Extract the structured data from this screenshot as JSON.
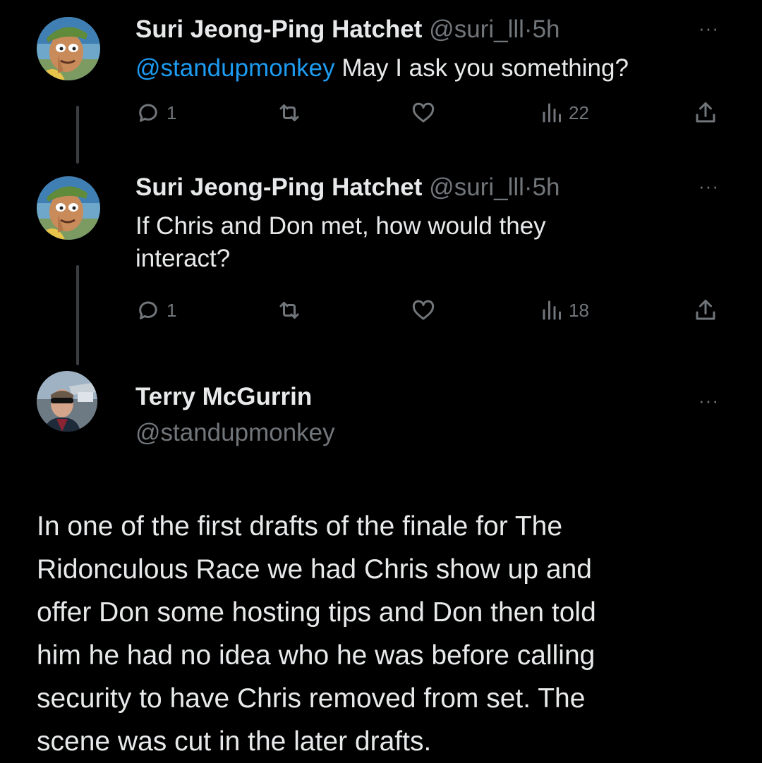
{
  "tweets": [
    {
      "author_name": "Suri Jeong-Ping Hatchet",
      "handle": "@suri_lll",
      "separator": "·",
      "time": "5h",
      "mention": "@standupmonkey",
      "text": " May I ask you something?",
      "reply_count": "1",
      "views": "22"
    },
    {
      "author_name": "Suri Jeong-Ping Hatchet",
      "handle": "@suri_lll",
      "separator": "·",
      "time": "5h",
      "text_line1": "If Chris and Don met, how would they",
      "text_line2": "interact?",
      "reply_count": "1",
      "views": "18"
    }
  ],
  "main_tweet": {
    "author_name": "Terry McGurrin",
    "handle": "@standupmonkey",
    "text_lines": [
      "In one of the first drafts of the finale for The",
      "Ridonculous Race we had Chris show up and",
      "offer Don some hosting tips and Don then told",
      "him he had no idea who he was before calling",
      "security to have Chris removed from set. The",
      "scene was cut in the later drafts."
    ]
  },
  "more_label": "···",
  "icons": [
    "reply-icon",
    "retweet-icon",
    "like-icon",
    "views-icon",
    "share-icon",
    "more-icon"
  ],
  "colors": {
    "background": "#000000",
    "text": "#e7e9ea",
    "muted": "#71767b",
    "link": "#1d9bf0"
  }
}
